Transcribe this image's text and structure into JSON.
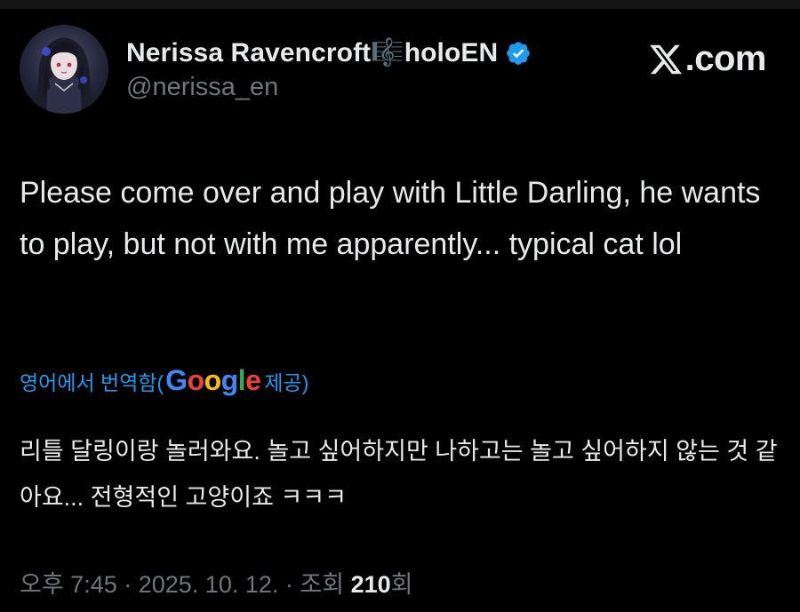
{
  "author": {
    "display_name": "Nerissa Ravencroft🎼holoEN",
    "handle": "@nerissa_en",
    "verified_icon": "verified-badge-icon",
    "verified_color": "#1d9bf0",
    "avatar_icon": "profile-avatar"
  },
  "brand": {
    "logo_icon": "x-logo-icon",
    "domain_suffix": ".com"
  },
  "tweet": {
    "text": "Please come over and play with Little Darling, he wants to play, but not with me apparently... typical cat lol"
  },
  "translation": {
    "prefix": "영어에서 번역함(",
    "provider": "Google",
    "suffix": " 제공)",
    "text": "리틀 달링이랑 놀러와요. 놀고 싶어하지만 나하고는 놀고 싶어하지 않는 것 같아요... 전형적인 고양이죠 ㅋㅋㅋ",
    "link_color": "#1d9bf0"
  },
  "meta": {
    "time": "오후 7:45",
    "separator": " · ",
    "date": "2025. 10. 12.",
    "views_label": "조회 ",
    "views_count": "210",
    "views_suffix": "회"
  },
  "colors": {
    "background": "#000000",
    "primary_text": "#e7e9ea",
    "secondary_text": "#71767b"
  }
}
